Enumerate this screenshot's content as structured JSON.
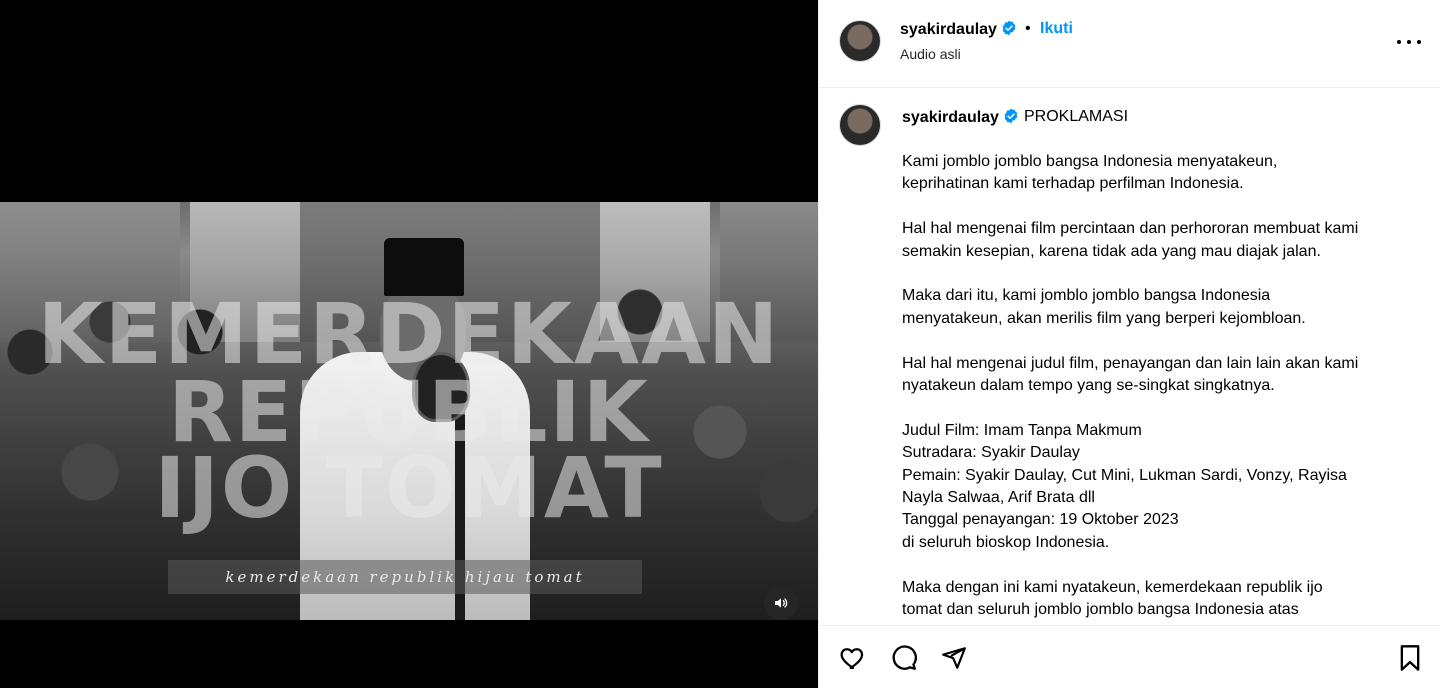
{
  "post": {
    "username": "syakirdaulay",
    "follow_label": "Ikuti",
    "separator": "•",
    "audio_label": "Audio asli",
    "caption_title": "PROKLAMASI",
    "caption_paragraphs": [
      [
        "Kami jomblo jomblo bangsa Indonesia menyatakeun,",
        "keprihatinan kami terhadap perfilman Indonesia."
      ],
      [
        "Hal hal mengenai film percintaan dan perhororan membuat kami",
        "semakin kesepian, karena tidak ada yang mau diajak jalan."
      ],
      [
        "Maka dari itu, kami jomblo jomblo bangsa Indonesia",
        "menyatakeun, akan merilis film yang berperi kejombloan."
      ],
      [
        "Hal hal mengenai judul film, penayangan dan lain lain akan kami",
        "nyatakeun dalam tempo yang se-singkat singkatnya."
      ],
      [
        "Judul Film: Imam Tanpa Makmum",
        "Sutradara: Syakir Daulay",
        "Pemain: Syakir Daulay, Cut Mini, Lukman Sardi, Vonzy, Rayisa",
        "Nayla Salwaa, Arif Brata dll",
        "Tanggal penayangan: 19 Oktober 2023",
        "di seluruh bioskop Indonesia."
      ],
      [
        "Maka dengan ini kami nyatakeun, kemerdekaan republik ijo",
        "tomat dan seluruh jomblo jomblo bangsa Indonesia atas"
      ]
    ]
  },
  "video": {
    "overlay_line1": "KEMERDEKAAN",
    "overlay_line2": "REPUBLIK",
    "overlay_line3": "IJO TOMAT",
    "subtitle": "kemerdekaan republik hijau tomat",
    "mute_icon": "speaker-icon"
  },
  "colors": {
    "accent": "#0095f6",
    "verified": "#0095f6",
    "text": "#000000"
  },
  "icons": {
    "like": "heart-icon",
    "comment": "comment-icon",
    "share": "share-icon",
    "save": "bookmark-icon",
    "more": "more-icon"
  }
}
